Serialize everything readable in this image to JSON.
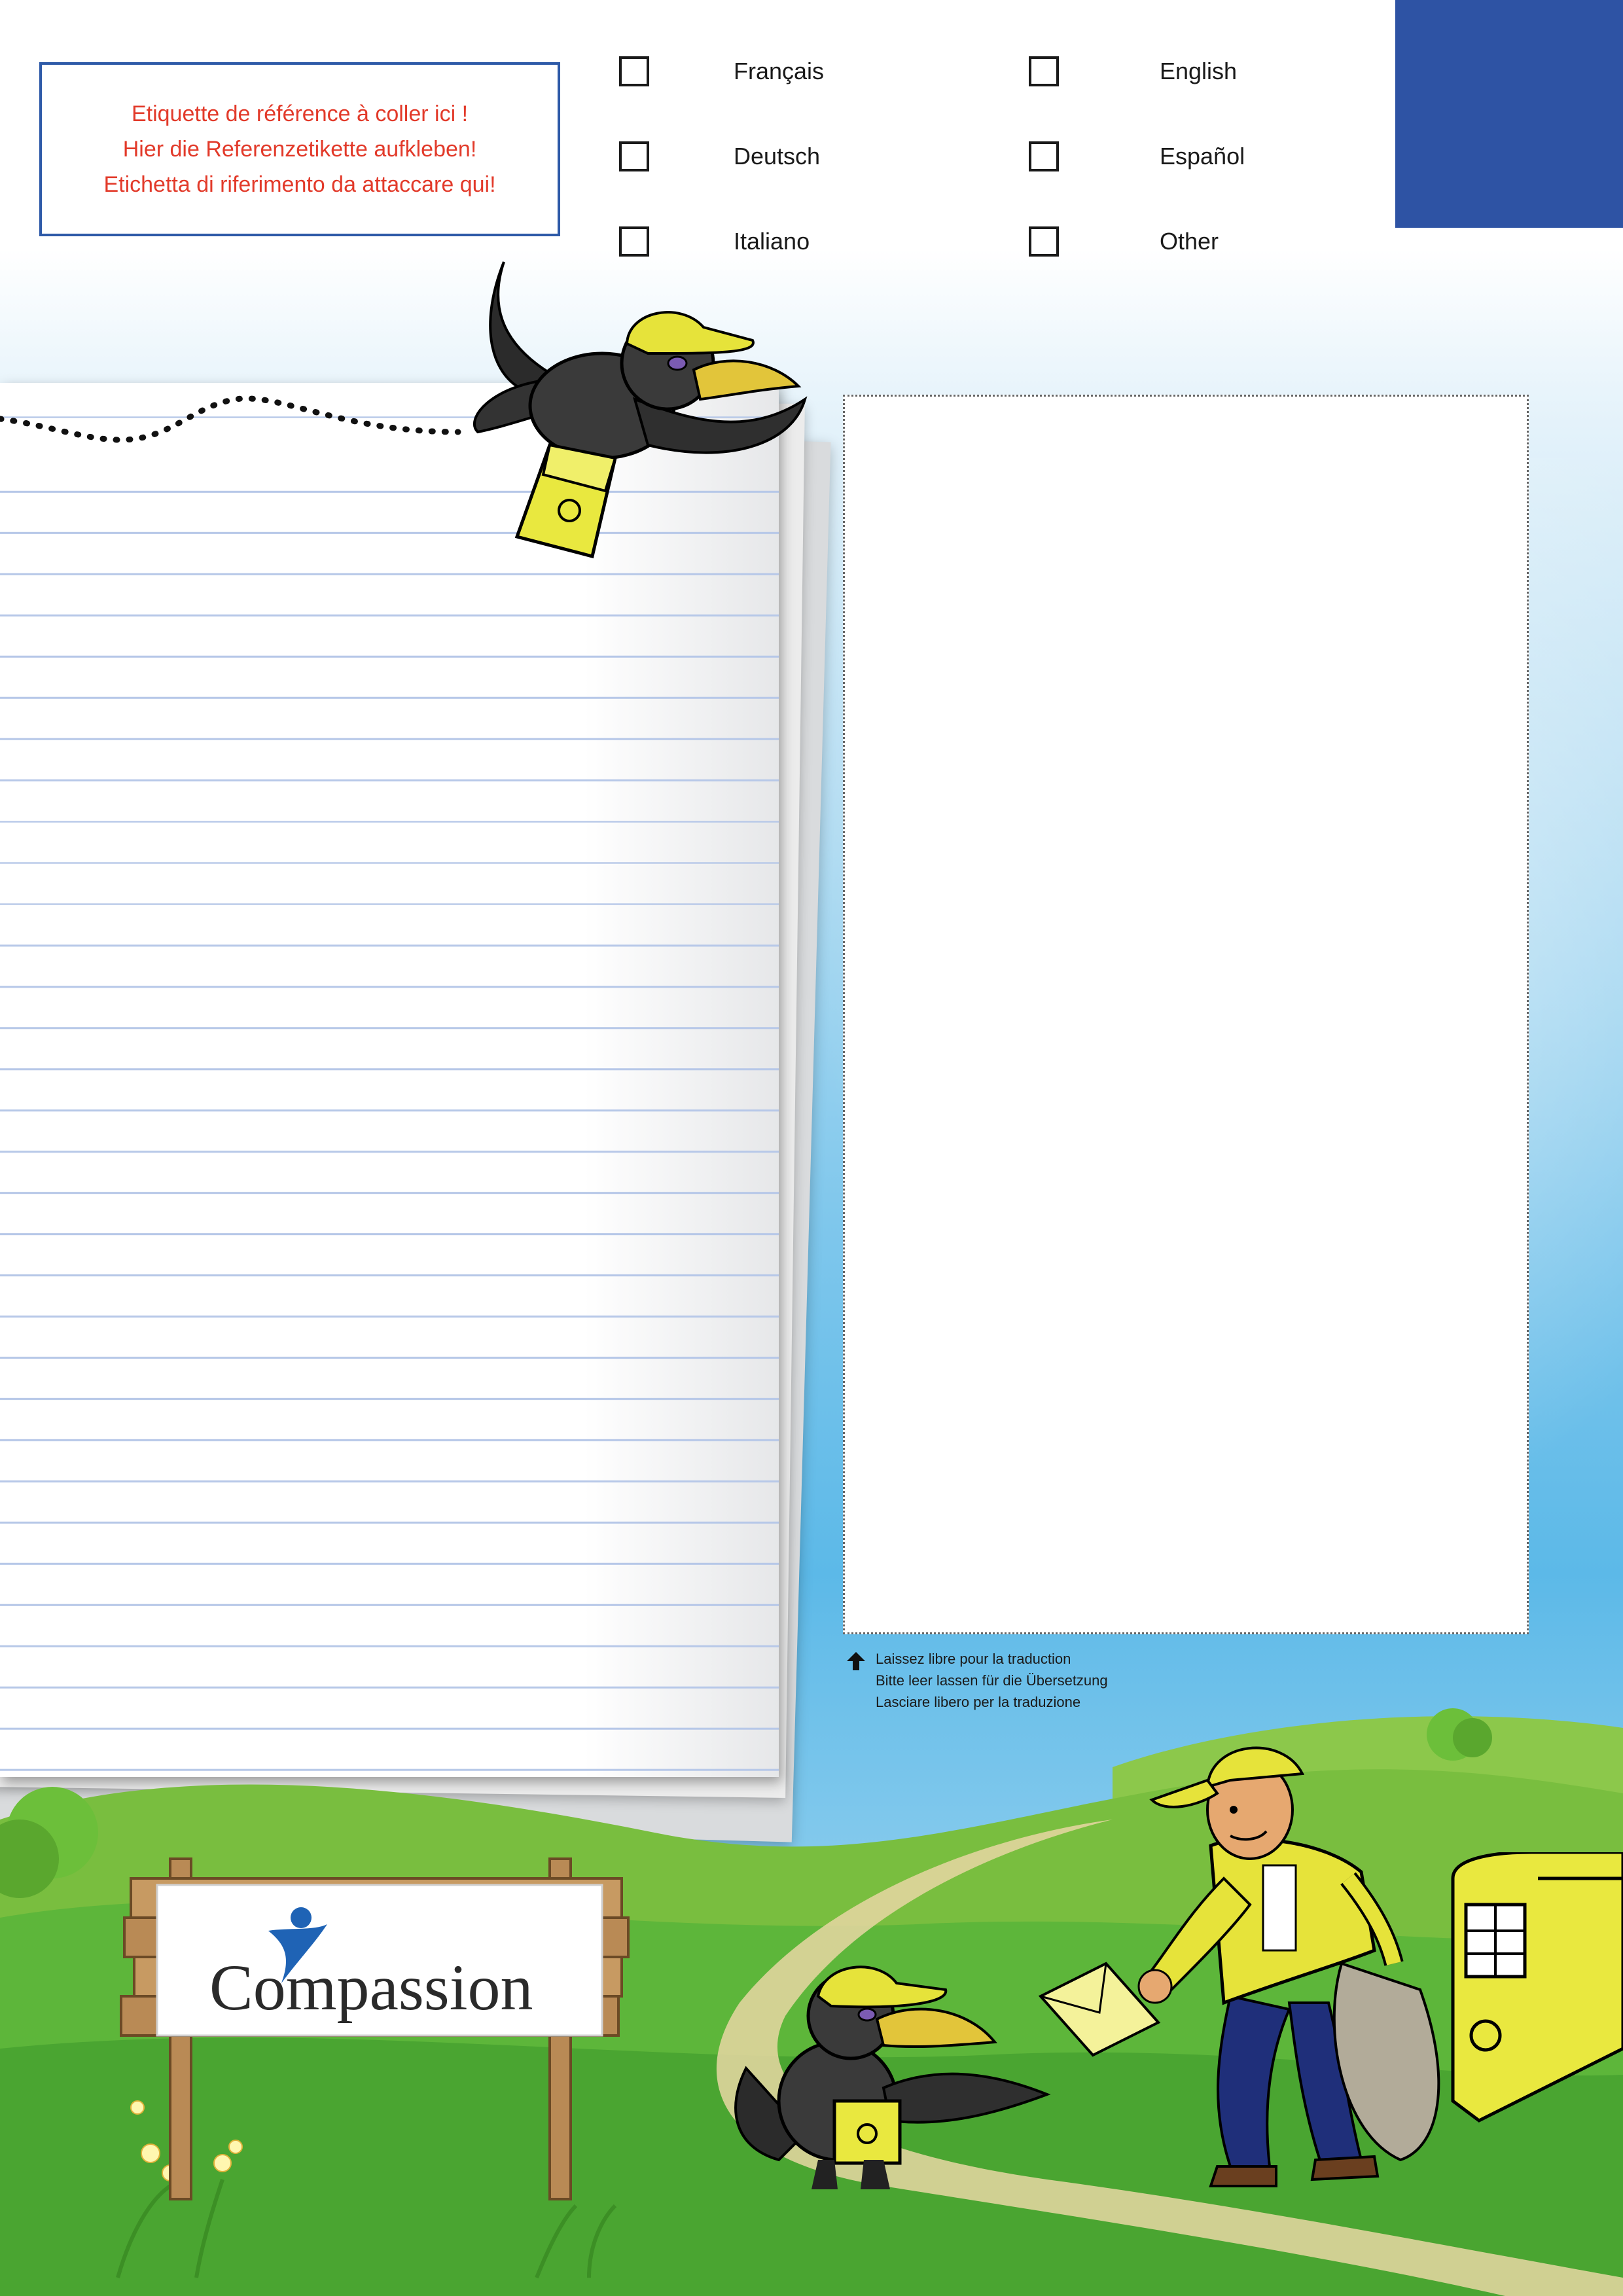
{
  "reference_label": {
    "lines": [
      "Etiquette de référence à coller ici !",
      "Hier die Referenzetikette aufkleben!",
      "Etichetta di riferimento da attaccare qui!"
    ]
  },
  "languages": [
    {
      "label": "Français",
      "checked": false
    },
    {
      "label": "English",
      "checked": false
    },
    {
      "label": "Deutsch",
      "checked": false
    },
    {
      "label": "Español",
      "checked": false
    },
    {
      "label": "Italiano",
      "checked": false
    },
    {
      "label": "Other",
      "checked": false
    }
  ],
  "translation_note": {
    "lines": [
      "Laissez libre pour la traduction",
      "Bitte leer lassen für die Übersetzung",
      "Lasciare libero per la traduzione"
    ]
  },
  "logo": {
    "text": "Compassion"
  },
  "colors": {
    "accent_blue": "#2e53a4",
    "label_red": "#e23a2a",
    "grass_green": "#5db63a"
  }
}
